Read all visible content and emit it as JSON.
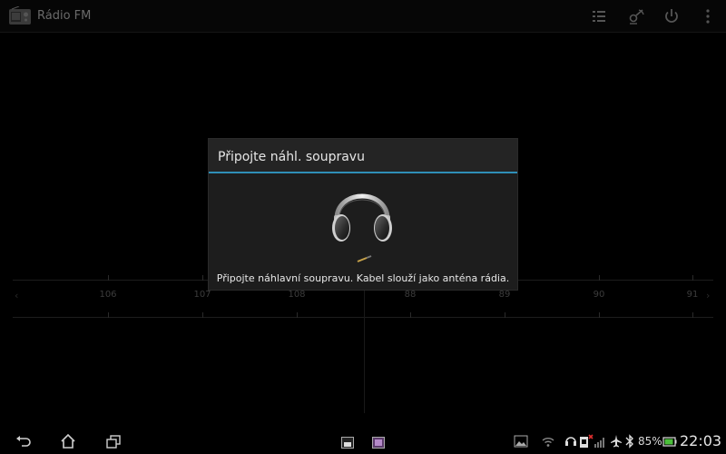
{
  "action_bar": {
    "title": "Rádio FM",
    "app_icon": "radio-icon",
    "actions": [
      "station-list-icon",
      "scan-icon",
      "power-icon",
      "overflow-menu-icon"
    ]
  },
  "tuner": {
    "frequencies": [
      "106",
      "107",
      "108",
      "88",
      "89",
      "90",
      "91"
    ],
    "left_arrow": "‹",
    "right_arrow": "›"
  },
  "dialog": {
    "title": "Připojte náhl. soupravu",
    "message": "Připojte náhlavní soupravu. Kabel slouží jako anténa rádia.",
    "illustration": "headphones-icon"
  },
  "system_bar": {
    "nav": [
      "back-icon",
      "home-icon",
      "recent-apps-icon"
    ],
    "battery_percent": "85%",
    "time": "22:03",
    "accent_color": "#2f8fb8"
  }
}
